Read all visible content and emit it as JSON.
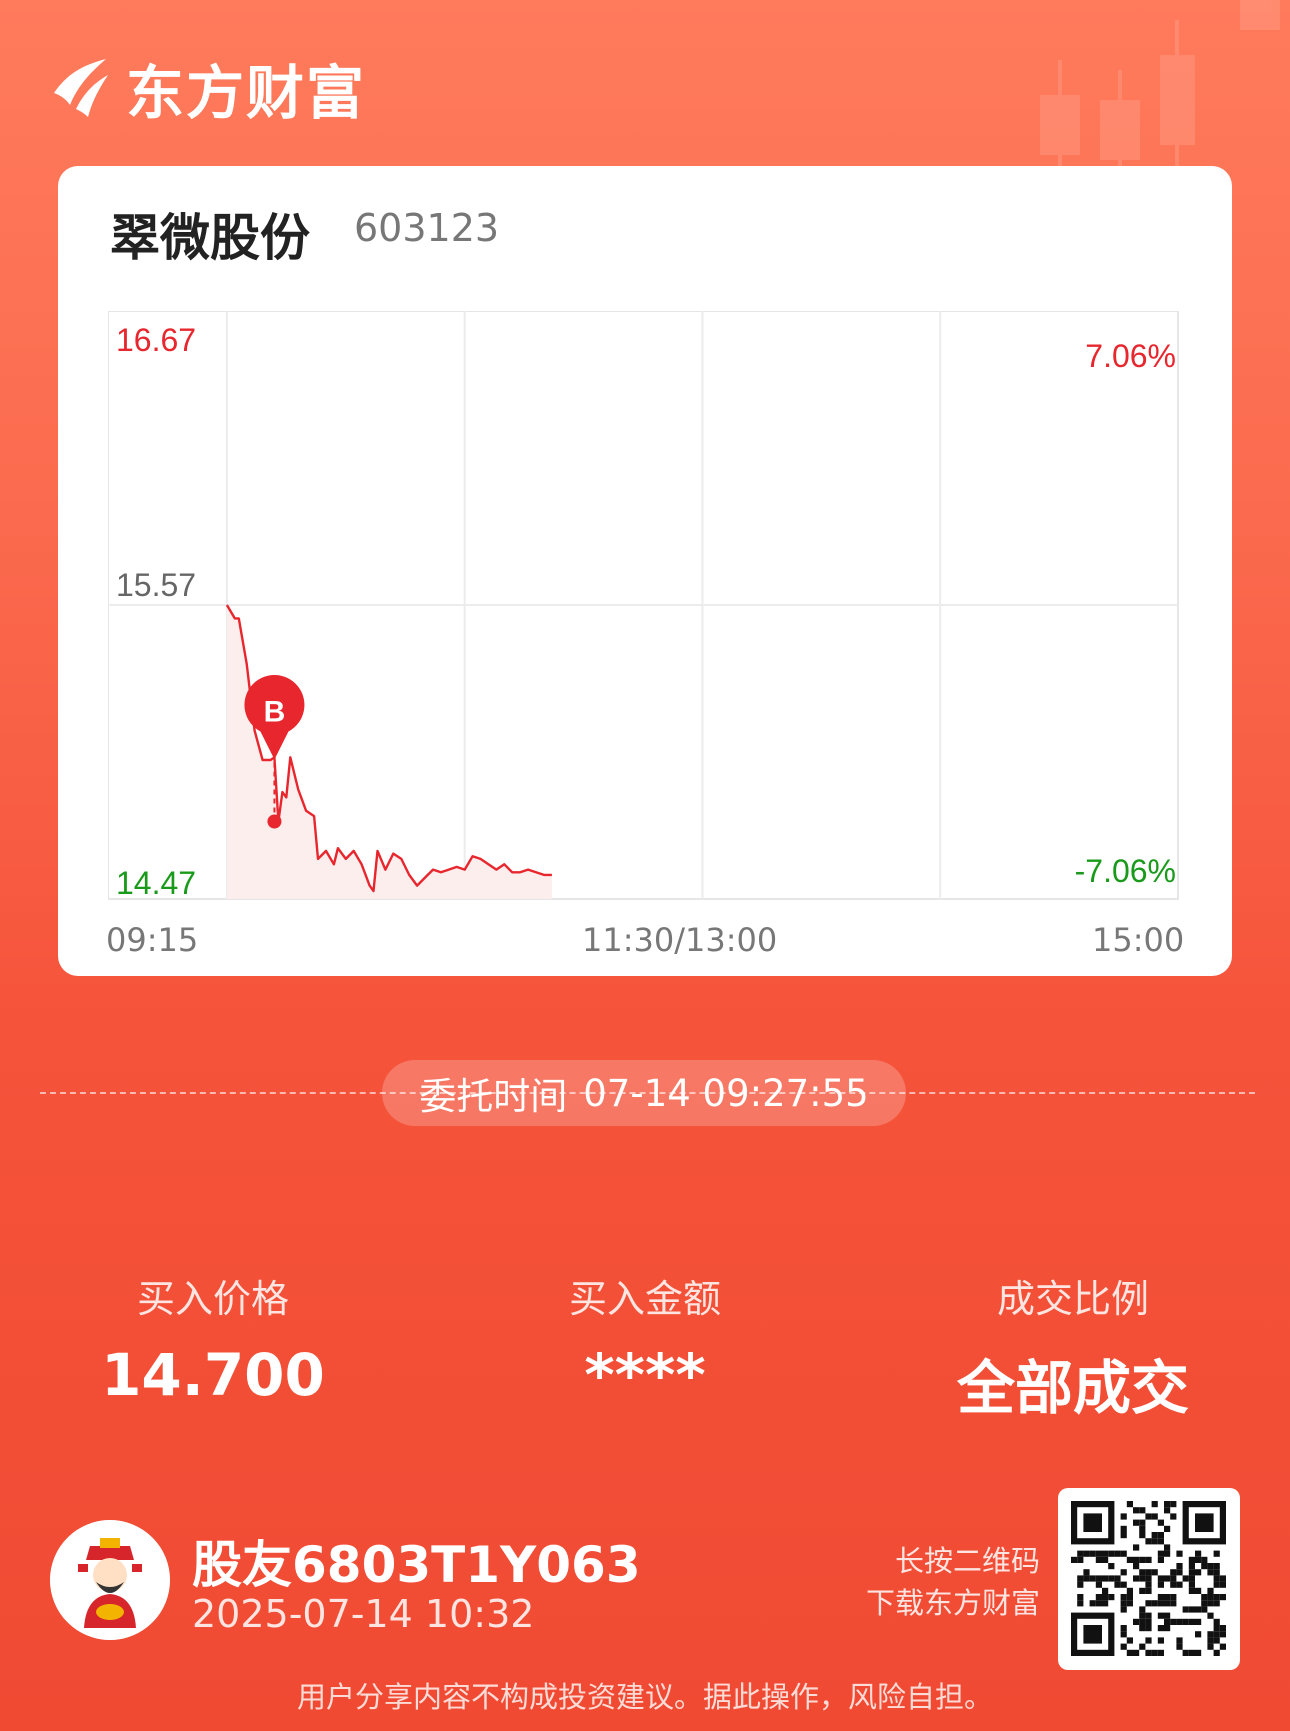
{
  "brand": {
    "name": "东方财富",
    "icon": "eastmoney-logo-icon"
  },
  "stock": {
    "name": "翠微股份",
    "code": "603123"
  },
  "chart_data": {
    "type": "line",
    "y_price_ticks": [
      "16.67",
      "15.57",
      "14.47"
    ],
    "y_pct_ticks": [
      "7.06%",
      "-7.06%"
    ],
    "x_labels": [
      "09:15",
      "11:30/13:00",
      "15:00"
    ],
    "ylim": [
      14.47,
      16.67
    ],
    "prev_close": 15.57,
    "grid": true,
    "colors": {
      "line": "#e8262d",
      "up": "#e8262d",
      "down": "#1a9a1a",
      "fill": "#fdeeee"
    },
    "x": [
      "09:30",
      "09:32",
      "09:33",
      "09:35",
      "09:37",
      "09:39",
      "09:40",
      "09:41",
      "09:42",
      "09:43",
      "09:44",
      "09:45",
      "09:46",
      "09:48",
      "09:50",
      "09:52",
      "09:53",
      "09:55",
      "09:57",
      "09:58",
      "10:00",
      "10:02",
      "10:04",
      "10:06",
      "10:07",
      "10:08",
      "10:10",
      "10:12",
      "10:14",
      "10:16",
      "10:18",
      "10:20",
      "10:22",
      "10:24",
      "10:26",
      "10:28",
      "10:30",
      "10:32",
      "10:34",
      "10:36",
      "10:38",
      "10:40",
      "10:42",
      "10:44",
      "10:46",
      "10:48",
      "10:50",
      "10:52"
    ],
    "values": [
      15.57,
      15.52,
      15.52,
      15.35,
      15.1,
      14.99,
      14.99,
      14.99,
      15.0,
      14.76,
      14.87,
      14.85,
      15.0,
      14.88,
      14.8,
      14.78,
      14.62,
      14.65,
      14.6,
      14.66,
      14.62,
      14.65,
      14.6,
      14.52,
      14.5,
      14.65,
      14.58,
      14.64,
      14.62,
      14.56,
      14.52,
      14.55,
      14.58,
      14.57,
      14.58,
      14.59,
      14.58,
      14.63,
      14.62,
      14.6,
      14.58,
      14.6,
      14.57,
      14.57,
      14.58,
      14.57,
      14.56,
      14.56
    ],
    "trade_marker": {
      "label": "B",
      "time": "09:42",
      "price": 14.76
    }
  },
  "order": {
    "label": "委托时间",
    "time": "07-14 09:27:55"
  },
  "stats": [
    {
      "label": "买入价格",
      "value": "14.700"
    },
    {
      "label": "买入金额",
      "value": "****"
    },
    {
      "label": "成交比例",
      "value": "全部成交"
    }
  ],
  "user": {
    "name": "股友6803T1Y063",
    "time": "2025-07-14 10:32",
    "avatar": "god-of-wealth-avatar-icon"
  },
  "qr": {
    "line1": "长按二维码",
    "line2": "下载东方财富"
  },
  "disclaimer": "用户分享内容不构成投资建议。据此操作，风险自担。"
}
